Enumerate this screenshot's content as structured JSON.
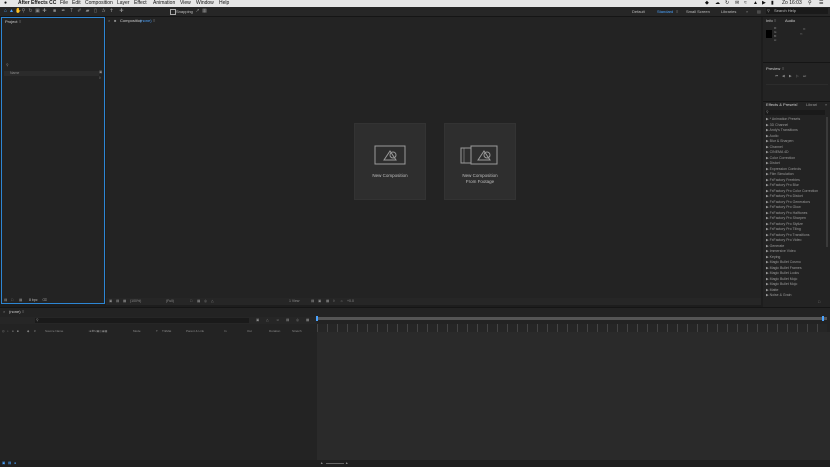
{
  "menubar": {
    "app_name": "After Effects CC",
    "items": [
      "File",
      "Edit",
      "Composition",
      "Layer",
      "Effect",
      "Animation",
      "View",
      "Window",
      "Help"
    ],
    "clock": "Zo 16:03"
  },
  "toolbar": {
    "snapping_label": "Snapping",
    "workspaces": [
      "Default",
      "Standard",
      "Small Screen",
      "Libraries"
    ],
    "active_workspace": "Standard",
    "search_placeholder": "Search Help"
  },
  "project_panel": {
    "title": "Project",
    "name_column": "Name",
    "footer_label": "8 bpc"
  },
  "composition_panel": {
    "tab_label": "Composition",
    "tab_value": "(none)",
    "cards": [
      {
        "lines": [
          "New Composition"
        ]
      },
      {
        "lines": [
          "New Composition",
          "From Footage"
        ]
      }
    ],
    "footer": {
      "zoom": "(100%)",
      "resolution": "(Full)",
      "view": "1 View",
      "offset": "+0.0"
    }
  },
  "info_panel": {
    "tabs": [
      "Info",
      "Audio"
    ],
    "readouts": [
      "R:",
      "G:",
      "B:",
      "A:"
    ],
    "coords": [
      "X:",
      "Y:"
    ]
  },
  "preview_panel": {
    "title": "Preview"
  },
  "effects_panel": {
    "tabs": [
      "Effects & Presets",
      "Librari"
    ],
    "items": [
      "* Animation Presets",
      "3D Channel",
      "Andy's Transitions",
      "Audio",
      "Blur & Sharpen",
      "Channel",
      "CINEMA 4D",
      "Color Correction",
      "Distort",
      "Expression Controls",
      "Film Simulation",
      "FxFactory Freebies",
      "FxFactory Pro Blur",
      "FxFactory Pro Color Correction",
      "FxFactory Pro Distort",
      "FxFactory Pro Generators",
      "FxFactory Pro Glow",
      "FxFactory Pro Halftones",
      "FxFactory Pro Sharpen",
      "FxFactory Pro Stylize",
      "FxFactory Pro Tiling",
      "FxFactory Pro Transitions",
      "FxFactory Pro Video",
      "Generate",
      "Immersive Video",
      "Keying",
      "Magic Bullet Cosmo",
      "Magic Bullet Frames",
      "Magic Bullet Looks",
      "Magic Bullet Mojo",
      "Magic Bullet Mojo",
      "Matte",
      "Noise & Grain"
    ]
  },
  "timeline": {
    "tab_label": "(none)",
    "columns": [
      "Source Name",
      "Mode",
      "T",
      "TrkMat",
      "Parent & Link",
      "In",
      "Out",
      "Duration",
      "Stretch"
    ]
  }
}
